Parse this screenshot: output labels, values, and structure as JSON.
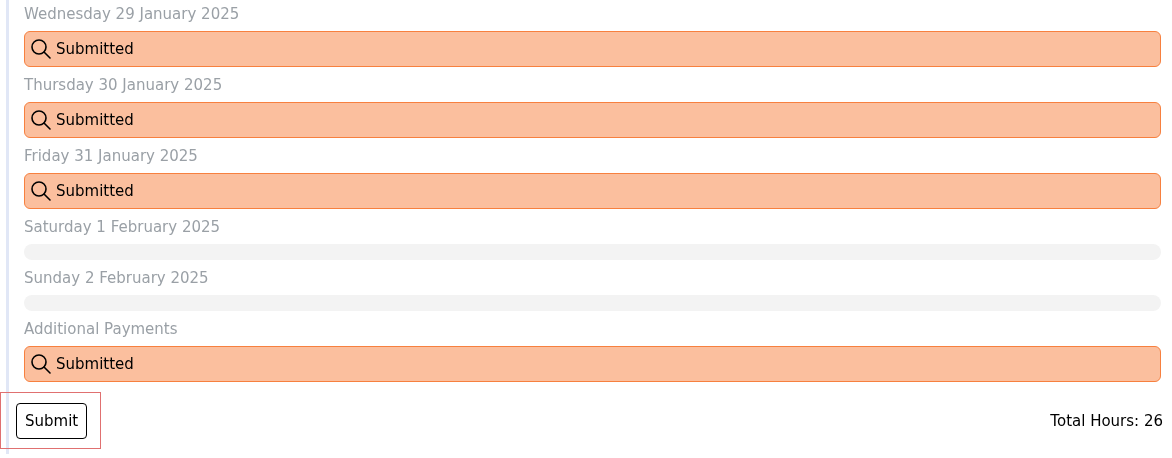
{
  "days": [
    {
      "label": "Wednesday 29 January 2025",
      "kind": "entry",
      "status": "Submitted"
    },
    {
      "label": "Thursday 30 January 2025",
      "kind": "entry",
      "status": "Submitted"
    },
    {
      "label": "Friday 31 January 2025",
      "kind": "entry",
      "status": "Submitted"
    },
    {
      "label": "Saturday 1 February 2025",
      "kind": "empty"
    },
    {
      "label": "Sunday 2 February 2025",
      "kind": "empty"
    },
    {
      "label": "Additional Payments",
      "kind": "entry",
      "status": "Submitted"
    }
  ],
  "submit": {
    "label": "Submit",
    "focused": true
  },
  "total": "Total Hours: 26"
}
